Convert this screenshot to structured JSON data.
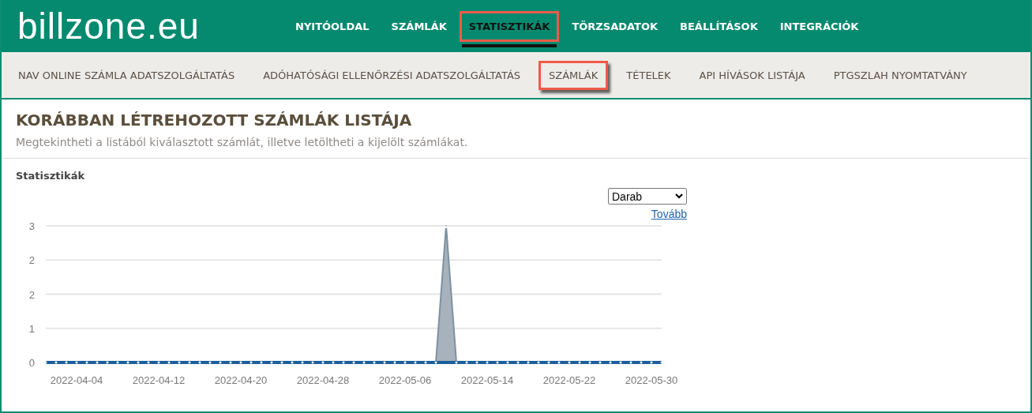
{
  "header": {
    "logo": "billzone.eu",
    "nav": [
      {
        "label": "NYITÓOLDAL",
        "selected": false
      },
      {
        "label": "SZÁMLÁK",
        "selected": false
      },
      {
        "label": "STATISZTIKÁK",
        "selected": true
      },
      {
        "label": "TÖRZSADATOK",
        "selected": false
      },
      {
        "label": "BEÁLLÍTÁSOK",
        "selected": false
      },
      {
        "label": "INTEGRÁCIÓK",
        "selected": false
      }
    ]
  },
  "subnav": [
    {
      "label": "NAV ONLINE SZÁMLA ADATSZOLGÁLTATÁS",
      "selected": false
    },
    {
      "label": "ADÓHATÓSÁGI ELLENŐRZÉSI ADATSZOLGÁLTATÁS",
      "selected": false
    },
    {
      "label": "SZÁMLÁK",
      "selected": true
    },
    {
      "label": "TÉTELEK",
      "selected": false
    },
    {
      "label": "API HÍVÁSOK LISTÁJA",
      "selected": false
    },
    {
      "label": "PTGSZLAH NYOMTATVÁNY",
      "selected": false
    }
  ],
  "page": {
    "title": "KORÁBBAN LÉTREHOZOTT SZÁMLÁK LISTÁJA",
    "subtitle": "Megtekintheti a listából kiválasztott számlát, illetve letöltheti a kijelölt számlákat."
  },
  "stats": {
    "heading": "Statisztikák",
    "unit_select": "Darab",
    "more_link": "Tovább",
    "chart_data": {
      "type": "area",
      "categories": [
        null,
        null,
        null,
        "2022-04-04",
        null,
        null,
        null,
        null,
        null,
        null,
        null,
        "2022-04-12",
        null,
        null,
        null,
        null,
        null,
        null,
        null,
        "2022-04-20",
        null,
        null,
        null,
        null,
        null,
        null,
        null,
        "2022-04-28",
        null,
        null,
        null,
        null,
        null,
        null,
        null,
        "2022-05-06",
        null,
        null,
        null,
        null,
        null,
        null,
        null,
        "2022-05-14",
        null,
        null,
        null,
        null,
        null,
        null,
        null,
        "2022-05-22",
        null,
        null,
        null,
        null,
        null,
        null,
        null,
        "2022-05-30",
        null
      ],
      "series": [
        {
          "color": "#a7b2bc",
          "values": [
            0,
            0,
            0,
            0,
            0,
            0,
            0,
            0,
            0,
            0,
            0,
            0,
            0,
            0,
            0,
            0,
            0,
            0,
            0,
            0,
            0,
            0,
            0,
            0,
            0,
            0,
            0,
            0,
            0,
            0,
            0,
            0,
            0,
            0,
            0,
            0,
            0,
            0,
            0,
            3,
            0,
            0,
            0,
            0,
            0,
            0,
            0,
            0,
            0,
            0,
            0,
            0,
            0,
            0,
            0,
            0,
            0,
            0,
            0,
            0,
            0
          ]
        }
      ],
      "ylim": [
        0,
        3
      ],
      "grid": true,
      "yticks": [
        {
          "value": 0,
          "label": "0"
        },
        {
          "value": 0.75,
          "label": "1"
        },
        {
          "value": 1.5,
          "label": "2"
        },
        {
          "value": 2.25,
          "label": "2"
        },
        {
          "value": 3,
          "label": "3"
        }
      ]
    }
  }
}
